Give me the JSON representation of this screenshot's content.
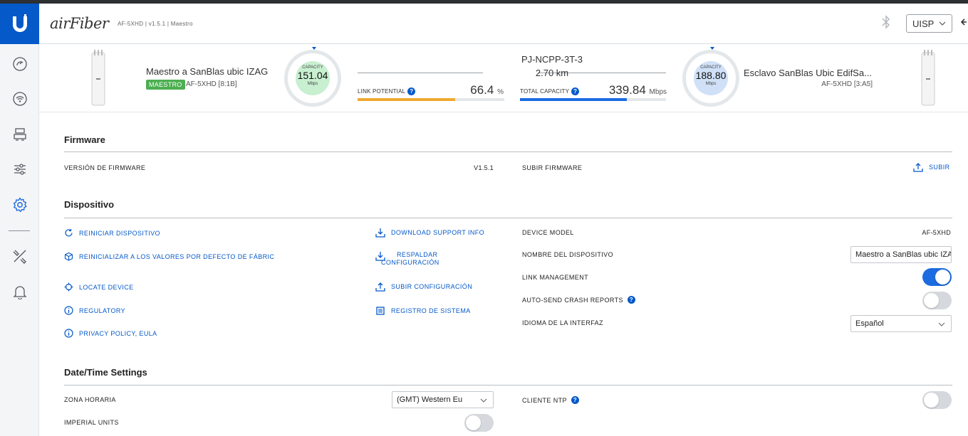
{
  "header": {
    "brand": "airFiber",
    "subtitle": "AF-5XHD | v1.5.1 | Maestro",
    "network_select": "UISP"
  },
  "sidebar": {
    "items": [
      "dashboard-icon",
      "wireless-icon",
      "network-icon",
      "services-icon",
      "settings-icon",
      "tools-icon",
      "notifications-icon"
    ],
    "active": "settings-icon"
  },
  "link": {
    "local": {
      "name": "Maestro a SanBlas ubic IZAG",
      "role": "MAESTRO",
      "model": "AF-5XHD [8:1B]",
      "capacity_label": "CAPACITY",
      "capacity": "151.04",
      "capacity_unit": "Mbps"
    },
    "remote": {
      "name": "Esclavo SanBlas Ubic EdifSa...",
      "model": "AF-5XHD [3:A5]",
      "capacity_label": "CAPACITY",
      "capacity": "188.80",
      "capacity_unit": "Mbps"
    },
    "title": "PJ-NCPP-3T-3",
    "distance": "2.70 km",
    "link_potential_label": "LINK POTENTIAL",
    "link_potential_value": "66.4",
    "link_potential_unit": "%",
    "link_potential_fraction": 0.664,
    "total_capacity_label": "TOTAL CAPACITY",
    "total_capacity_value": "339.84",
    "total_capacity_unit": "Mbps",
    "total_capacity_fraction": 0.73,
    "colors": {
      "potential_bar": "#f0a830",
      "capacity_bar": "#1c6be0",
      "local_gauge": "#c8efd0",
      "remote_gauge": "#cfe0f7"
    }
  },
  "firmware": {
    "title": "Firmware",
    "version_label": "VERSIÓN DE FIRMWARE",
    "version_value": "V1.5.1",
    "upload_label": "SUBIR FIRMWARE",
    "upload_button": "SUBIR"
  },
  "device": {
    "title": "Dispositivo",
    "actions_left": [
      "REINICIAR DISPOSITIVO",
      "REINICIALIZAR A LOS VALORES POR DEFECTO DE FÁBRIC",
      "LOCATE DEVICE",
      "REGULATORY",
      "PRIVACY POLICY, EULA"
    ],
    "actions_mid": [
      "DOWNLOAD SUPPORT INFO",
      "RESPALDAR",
      "CONFIGURACIÓN",
      "SUBIR CONFIGURACIÓN",
      "REGISTRO DE SISTEMA"
    ],
    "model_label": "DEVICE MODEL",
    "model_value": "AF-5XHD",
    "name_label": "NOMBRE DEL DISPOSITIVO",
    "name_value": "Maestro a SanBlas ubic IZAG",
    "link_mgmt_label": "LINK MANAGEMENT",
    "link_mgmt_on": true,
    "crash_label": "AUTO-SEND CRASH REPORTS",
    "crash_on": false,
    "lang_label": "IDIOMA DE LA INTERFAZ",
    "lang_value": "Español"
  },
  "datetime": {
    "title": "Date/Time Settings",
    "tz_label": "ZONA HORARIA",
    "tz_value": "(GMT) Western Eu",
    "imperial_label": "IMPERIAL UNITS",
    "imperial_on": false,
    "ntp_label": "CLIENTE NTP",
    "ntp_on": false
  }
}
